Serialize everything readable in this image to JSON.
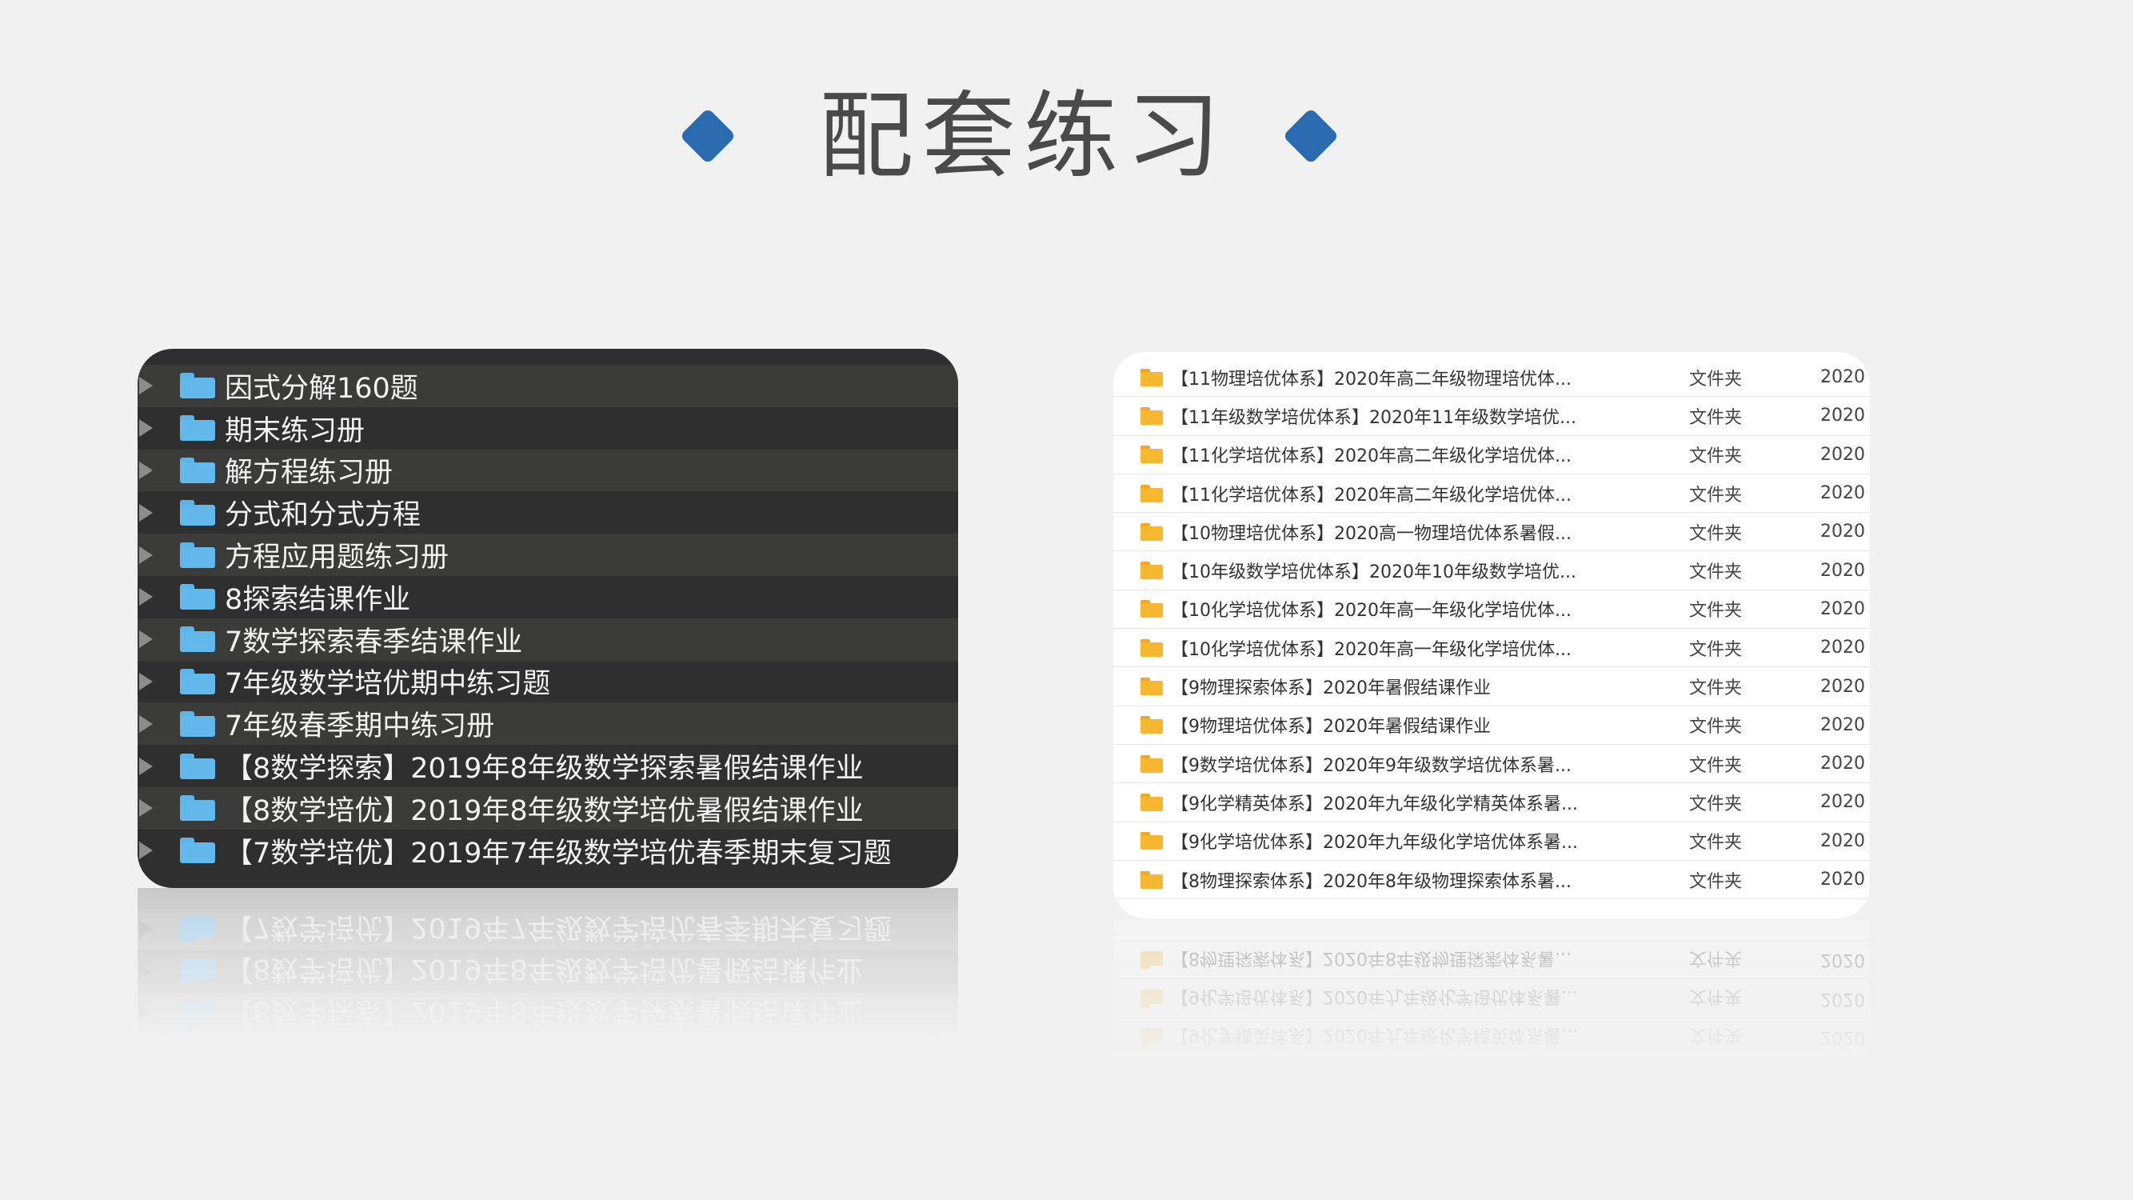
{
  "page": {
    "title": "配套练习",
    "accent_color": "#2b6cb0"
  },
  "dark_panel": {
    "items": [
      {
        "label": "因式分解160题"
      },
      {
        "label": "期末练习册"
      },
      {
        "label": "解方程练习册"
      },
      {
        "label": "分式和分式方程"
      },
      {
        "label": "方程应用题练习册"
      },
      {
        "label": "8探索结课作业"
      },
      {
        "label": "7数学探索春季结课作业"
      },
      {
        "label": "7年级数学培优期中练习题"
      },
      {
        "label": "7年级春季期中练习册"
      },
      {
        "label": "【8数学探索】2019年8年级数学探索暑假结课作业"
      },
      {
        "label": "【8数学培优】2019年8年级数学培优暑假结课作业"
      },
      {
        "label": "【7数学培优】2019年7年级数学培优春季期末复习题"
      }
    ]
  },
  "white_panel": {
    "rows": [
      {
        "name": "【11物理培优体系】2020年高二年级物理培优体...",
        "type": "文件夹",
        "date": "2020"
      },
      {
        "name": "【11年级数学培优体系】2020年11年级数学培优...",
        "type": "文件夹",
        "date": "2020"
      },
      {
        "name": "【11化学培优体系】2020年高二年级化学培优体...",
        "type": "文件夹",
        "date": "2020"
      },
      {
        "name": "【11化学培优体系】2020年高二年级化学培优体...",
        "type": "文件夹",
        "date": "2020"
      },
      {
        "name": "【10物理培优体系】2020高一物理培优体系暑假...",
        "type": "文件夹",
        "date": "2020"
      },
      {
        "name": "【10年级数学培优体系】2020年10年级数学培优...",
        "type": "文件夹",
        "date": "2020"
      },
      {
        "name": "【10化学培优体系】2020年高一年级化学培优体...",
        "type": "文件夹",
        "date": "2020"
      },
      {
        "name": "【10化学培优体系】2020年高一年级化学培优体...",
        "type": "文件夹",
        "date": "2020"
      },
      {
        "name": "【9物理探索体系】2020年暑假结课作业",
        "type": "文件夹",
        "date": "2020"
      },
      {
        "name": "【9物理培优体系】2020年暑假结课作业",
        "type": "文件夹",
        "date": "2020"
      },
      {
        "name": "【9数学培优体系】2020年9年级数学培优体系暑...",
        "type": "文件夹",
        "date": "2020"
      },
      {
        "name": "【9化学精英体系】2020年九年级化学精英体系暑...",
        "type": "文件夹",
        "date": "2020"
      },
      {
        "name": "【9化学培优体系】2020年九年级化学培优体系暑...",
        "type": "文件夹",
        "date": "2020"
      },
      {
        "name": "【8物理探索体系】2020年8年级物理探索体系暑...",
        "type": "文件夹",
        "date": "2020"
      }
    ]
  }
}
